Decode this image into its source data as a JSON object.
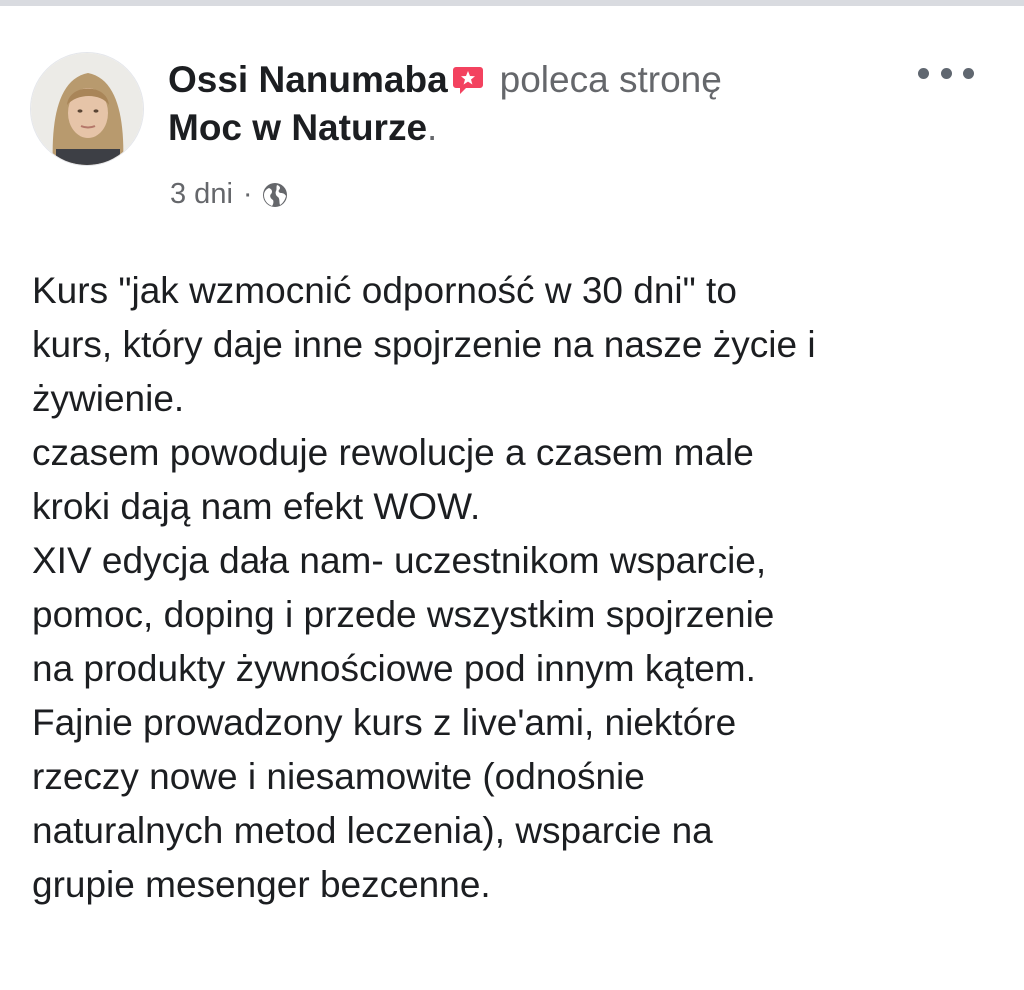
{
  "post": {
    "author": "Ossi Nanumaba",
    "action_text": "poleca stronę",
    "page_name": "Moc w Naturze",
    "page_suffix": ".",
    "time": "3 dni",
    "separator": "·",
    "audience_icon": "globe-icon",
    "recommend_icon": "recommend-badge-icon",
    "more_icon": "more-options-icon",
    "body_lines": [
      "Kurs \"jak wzmocnić odporność w 30 dni\" to",
      "kurs, który daje inne spojrzenie na nasze życie i",
      "żywienie.",
      "czasem powoduje rewolucje a czasem male",
      "kroki dają nam efekt WOW.",
      "XIV edycja dała nam- uczestnikom wsparcie,",
      "pomoc, doping i przede wszystkim spojrzenie",
      "na produkty żywnościowe pod innym kątem.",
      "Fajnie prowadzony kurs z live'ami, niektóre",
      "rzeczy nowe i niesamowite (odnośnie",
      "naturalnych metod leczenia), wsparcie na",
      "grupie mesenger bezcenne."
    ]
  },
  "colors": {
    "recommend_badge": "#f3425f",
    "secondary_text": "#65676b",
    "primary_text": "#1c1e21"
  }
}
